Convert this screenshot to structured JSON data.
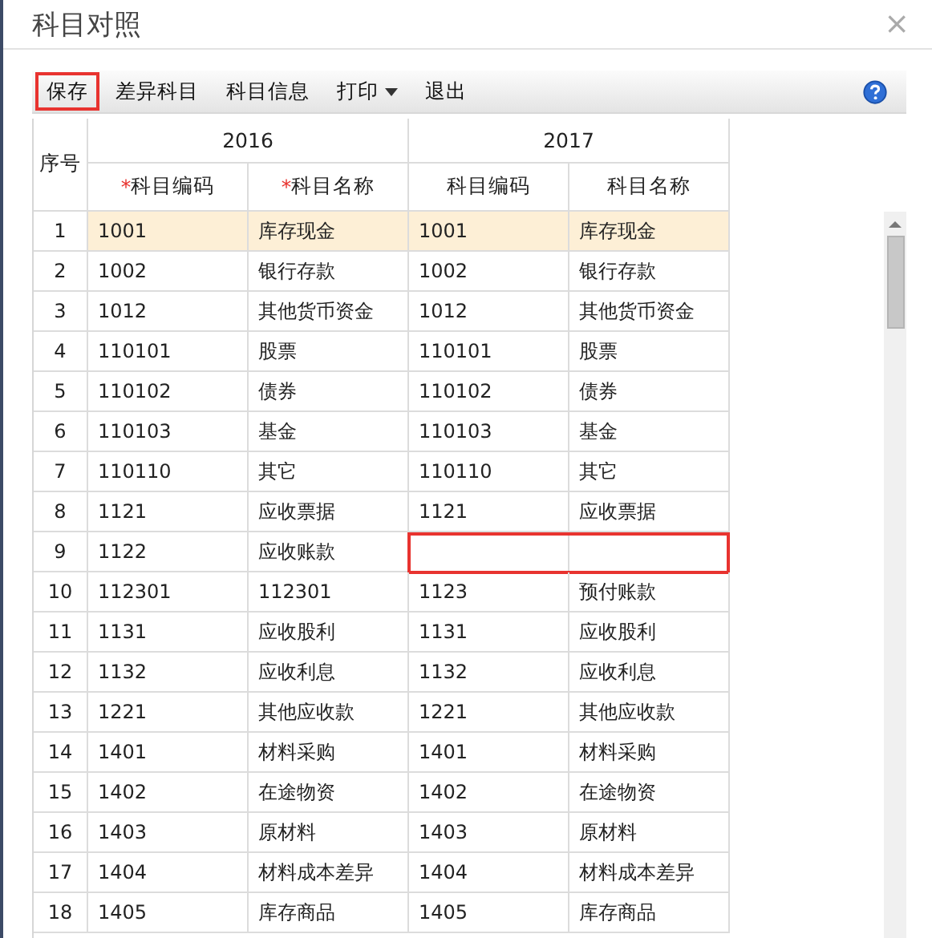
{
  "window": {
    "title": "科目对照",
    "close": "×"
  },
  "toolbar": [
    {
      "label": "保存",
      "outlined": true,
      "dropdown": false
    },
    {
      "label": "差异科目",
      "outlined": false,
      "dropdown": false
    },
    {
      "label": "科目信息",
      "outlined": false,
      "dropdown": false
    },
    {
      "label": "打印",
      "outlined": false,
      "dropdown": true
    },
    {
      "label": "退出",
      "outlined": false,
      "dropdown": false
    }
  ],
  "table": {
    "seq_header": "序号",
    "groups": [
      "2016",
      "2017"
    ],
    "columns": [
      {
        "mark": "*",
        "label": "科目编码"
      },
      {
        "mark": "*",
        "label": "科目名称"
      },
      {
        "label": "科目编码"
      },
      {
        "label": "科目名称"
      }
    ],
    "rows": [
      {
        "seq": "1",
        "old_code": "1001",
        "old_name": "库存现金",
        "new_code": "1001",
        "new_name": "库存现金",
        "selected": true,
        "outlined": false
      },
      {
        "seq": "2",
        "old_code": "1002",
        "old_name": "银行存款",
        "new_code": "1002",
        "new_name": "银行存款",
        "selected": false,
        "outlined": false
      },
      {
        "seq": "3",
        "old_code": "1012",
        "old_name": "其他货币资金",
        "new_code": "1012",
        "new_name": "其他货币资金",
        "selected": false,
        "outlined": false
      },
      {
        "seq": "4",
        "old_code": "110101",
        "old_name": "股票",
        "new_code": "110101",
        "new_name": "股票",
        "selected": false,
        "outlined": false
      },
      {
        "seq": "5",
        "old_code": "110102",
        "old_name": "债券",
        "new_code": "110102",
        "new_name": "债券",
        "selected": false,
        "outlined": false
      },
      {
        "seq": "6",
        "old_code": "110103",
        "old_name": "基金",
        "new_code": "110103",
        "new_name": "基金",
        "selected": false,
        "outlined": false
      },
      {
        "seq": "7",
        "old_code": "110110",
        "old_name": "其它",
        "new_code": "110110",
        "new_name": "其它",
        "selected": false,
        "outlined": false
      },
      {
        "seq": "8",
        "old_code": "1121",
        "old_name": "应收票据",
        "new_code": "1121",
        "new_name": "应收票据",
        "selected": false,
        "outlined": false
      },
      {
        "seq": "9",
        "old_code": "1122",
        "old_name": "应收账款",
        "selected": false,
        "outlined": true
      },
      {
        "seq": "10",
        "old_code": "112301",
        "old_name": "112301",
        "new_code": "1123",
        "new_name": "预付账款",
        "selected": false,
        "outlined": false
      },
      {
        "seq": "11",
        "old_code": "1131",
        "old_name": "应收股利",
        "new_code": "1131",
        "new_name": "应收股利",
        "selected": false,
        "outlined": false
      },
      {
        "seq": "12",
        "old_code": "1132",
        "old_name": "应收利息",
        "new_code": "1132",
        "new_name": "应收利息",
        "selected": false,
        "outlined": false
      },
      {
        "seq": "13",
        "old_code": "1221",
        "old_name": "其他应收款",
        "new_code": "1221",
        "new_name": "其他应收款",
        "selected": false,
        "outlined": false
      },
      {
        "seq": "14",
        "old_code": "1401",
        "old_name": "材料采购",
        "new_code": "1401",
        "new_name": "材料采购",
        "selected": false,
        "outlined": false
      },
      {
        "seq": "15",
        "old_code": "1402",
        "old_name": "在途物资",
        "new_code": "1402",
        "new_name": "在途物资",
        "selected": false,
        "outlined": false
      },
      {
        "seq": "16",
        "old_code": "1403",
        "old_name": "原材料",
        "new_code": "1403",
        "new_name": "原材料",
        "selected": false,
        "outlined": false
      },
      {
        "seq": "17",
        "old_code": "1404",
        "old_name": "材料成本差异",
        "new_code": "1404",
        "new_name": "材料成本差异",
        "selected": false,
        "outlined": false
      },
      {
        "seq": "18",
        "old_code": "1405",
        "old_name": "库存商品",
        "new_code": "1405",
        "new_name": "库存商品",
        "selected": false,
        "outlined": false
      }
    ]
  }
}
